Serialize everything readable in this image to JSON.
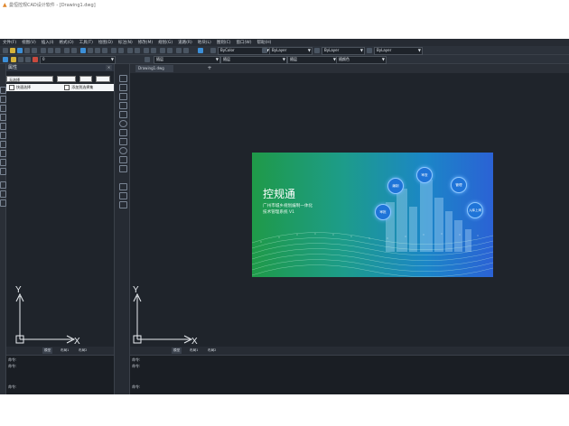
{
  "title": {
    "app_title": "曼恒控规CAD设计软件 - [Drawing1.dwg]"
  },
  "menubar": {
    "items": [
      "文件(F)",
      "视图(V)",
      "插入(I)",
      "格式(O)",
      "工具(T)",
      "绘图(D)",
      "标注(N)",
      "修改(M)",
      "规划(G)",
      "道路(R)",
      "地块(L)",
      "图则(C)",
      "窗口(W)",
      "帮助(H)"
    ]
  },
  "toolbar": {
    "layer_dropdown": "ByLayer",
    "linetype_dropdown": "ByLayer",
    "lineweight_dropdown": "ByLayer",
    "color_dropdown": "ByColor",
    "style_dropdown1": "随层",
    "style_dropdown2": "随层",
    "style_dropdown3": "随层",
    "plot_dropdown": "随颜色"
  },
  "properties_panel": {
    "title": "属性",
    "close_label": "×",
    "select_value": "无选择",
    "quick_select_label": "快速选择",
    "add_to_set_label": "添加到选择集"
  },
  "document": {
    "tab_label": "Drawing1.dwg",
    "new_tab_label": "+"
  },
  "splash": {
    "title": "控规通",
    "subtitle_line1": "广州市城乡规划编制一体化",
    "subtitle_line2": "技术管理系统 V1",
    "bubbles": [
      "编制",
      "审查",
      "管理",
      "审批",
      "入库上网"
    ]
  },
  "ucs": {
    "x_label": "X",
    "y_label": "Y"
  },
  "layout_tabs": {
    "model": "模型",
    "layout1": "布局1",
    "layout2": "布局2"
  },
  "command": {
    "prompt1": "命令:",
    "prompt2": "命令:",
    "prompt3": "命令:"
  },
  "colors": {
    "background": "#1f242b",
    "toolbar": "#2c323b",
    "accent": "#3c8fd8"
  }
}
